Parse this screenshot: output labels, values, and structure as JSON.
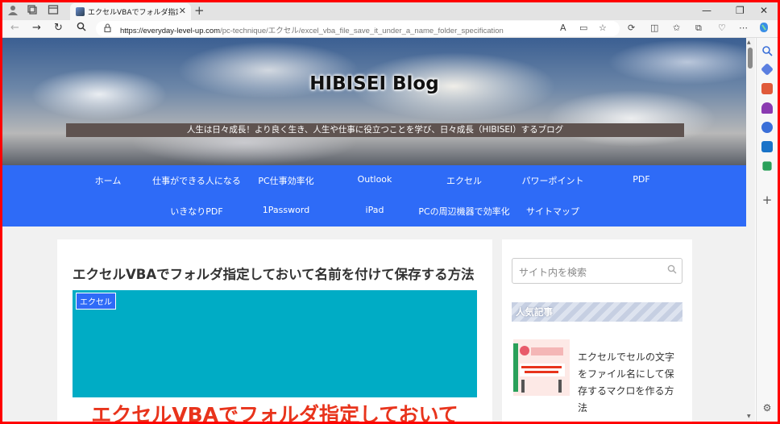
{
  "browser": {
    "tab_title": "エクセルVBAでフォルダ指定しておいて",
    "tab_close": "✕",
    "new_tab": "+",
    "url_host": "https://everyday-level-up.com",
    "url_path": "/pc-technique/エクセル/excel_vba_file_save_it_under_a_name_folder_specification",
    "win_min": "—",
    "win_max": "❐",
    "win_close": "✕"
  },
  "site": {
    "title": "HIBISEI Blog",
    "tagline": "人生は日々成長！より良く生き、人生や仕事に役立つことを学び、日々成長（HIBISEI）するブログ"
  },
  "nav": {
    "row1": [
      "ホーム",
      "仕事ができる人になる",
      "PC仕事効率化",
      "Outlook",
      "エクセル",
      "パワーポイント",
      "PDF"
    ],
    "row2": [
      "いきなりPDF",
      "1Password",
      "iPad",
      "PCの周辺機器で効率化",
      "サイトマップ"
    ]
  },
  "article": {
    "title": "エクセルVBAでフォルダ指定しておいて名前を付けて保存する方法",
    "category": "エクセル",
    "eyecatch_text": "エクセルVBAでフォルダ指定しておいて"
  },
  "sidebar": {
    "search_placeholder": "サイト内を検索",
    "popular_heading": "人気記事",
    "popular_item_title": "エクセルでセルの文字をファイル名にして保存するマクロを作る方法"
  },
  "colors": {
    "nav_blue": "#2e6bf7",
    "eyecatch_cyan": "#00acc5",
    "frame_red": "#ff0000"
  }
}
